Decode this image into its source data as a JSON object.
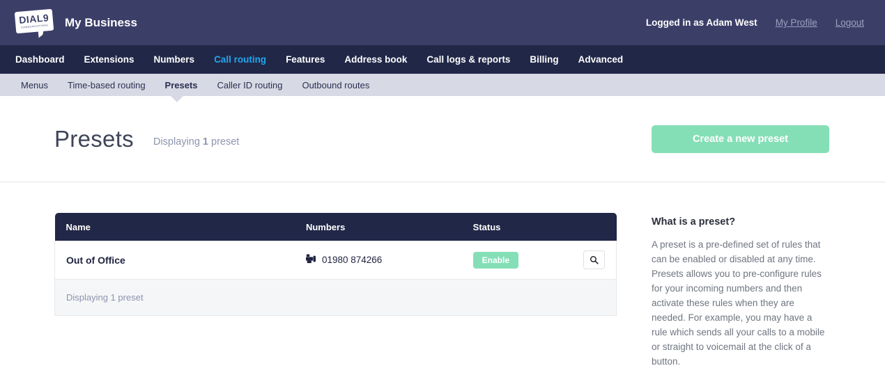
{
  "topbar": {
    "logo": {
      "icon": "dial9-logo-icon",
      "main": "DIAL9",
      "sub": "COMMUNICATIONS"
    },
    "brand_name": "My Business",
    "logged_in_text": "Logged in as Adam West",
    "profile_link": "My Profile",
    "logout_link": "Logout"
  },
  "mainnav": {
    "items": [
      {
        "label": "Dashboard",
        "active": false
      },
      {
        "label": "Extensions",
        "active": false
      },
      {
        "label": "Numbers",
        "active": false
      },
      {
        "label": "Call routing",
        "active": true
      },
      {
        "label": "Features",
        "active": false
      },
      {
        "label": "Address book",
        "active": false
      },
      {
        "label": "Call logs & reports",
        "active": false
      },
      {
        "label": "Billing",
        "active": false
      },
      {
        "label": "Advanced",
        "active": false
      }
    ]
  },
  "subnav": {
    "items": [
      {
        "label": "Menus",
        "active": false
      },
      {
        "label": "Time-based routing",
        "active": false
      },
      {
        "label": "Presets",
        "active": true
      },
      {
        "label": "Caller ID routing",
        "active": false
      },
      {
        "label": "Outbound routes",
        "active": false
      }
    ]
  },
  "page": {
    "title": "Presets",
    "subtitle_prefix": "Displaying ",
    "subtitle_count": "1",
    "subtitle_suffix": " preset",
    "create_button": "Create a new preset"
  },
  "table": {
    "columns": [
      "Name",
      "Numbers",
      "Status",
      ""
    ],
    "rows": [
      {
        "name": "Out of Office",
        "number_icon": "fax-icon",
        "number": "01980 874266",
        "status_label": "Enable",
        "action_icon": "search-icon"
      }
    ],
    "footer": "Displaying 1 preset"
  },
  "aside": {
    "heading": "What is a preset?",
    "body": "A preset is a pre-defined set of rules that can be enabled or disabled at any time. Presets allows you to pre-configure rules for your incoming numbers and then activate these rules when they are needed. For example, you may have a rule which sends all your calls to a mobile or straight to voicemail at the click of a button."
  },
  "colors": {
    "topbar": "#3b3f68",
    "mainnav": "#212747",
    "subnav": "#d7d9e4",
    "accent_blue": "#22a7f0",
    "accent_green": "#85dfb6"
  }
}
